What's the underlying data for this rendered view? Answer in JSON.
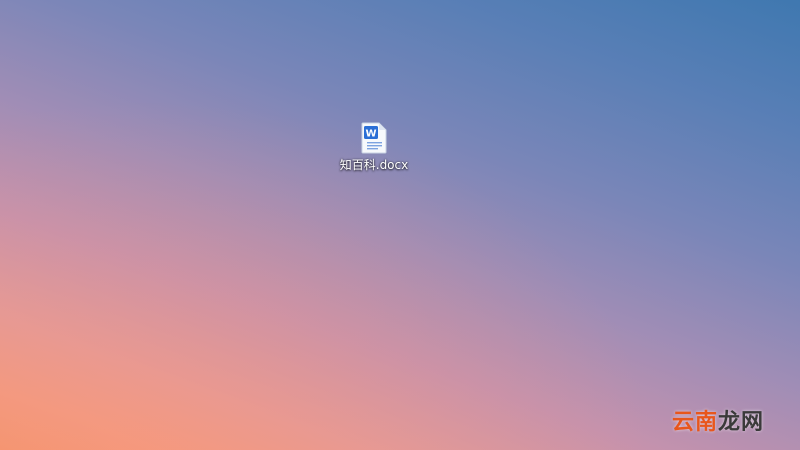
{
  "desktop": {
    "icons": [
      {
        "label": "知百科.docx",
        "icon": "word-document-icon",
        "icon_letter": "W",
        "accent": "#2b6fd6"
      }
    ]
  },
  "watermark": {
    "part1": "云南",
    "part2": "龙网",
    "color1": "#e8561c",
    "color2": "#3a3a3a"
  }
}
